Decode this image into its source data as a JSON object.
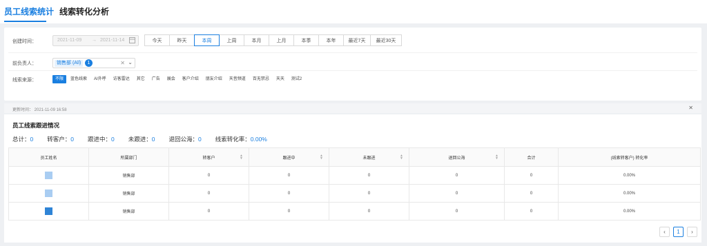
{
  "tabs": [
    {
      "label": "员工线索统计",
      "active": true
    },
    {
      "label": "线索转化分析",
      "active": false
    }
  ],
  "filters": {
    "created_label": "创建时间：",
    "date_start": "2021-11-09",
    "date_sep": "→",
    "date_end": "2021-11-14",
    "quick_ranges": [
      "今天",
      "昨天",
      "本周",
      "上周",
      "本月",
      "上月",
      "本季",
      "本年",
      "最近7天",
      "最近30天"
    ],
    "quick_active": "本周",
    "owner_label": "前负责人：",
    "owner_tag": "销售部 (All)",
    "owner_count": "1",
    "source_label": "线索来源：",
    "sources": [
      "不限",
      "蓝色线索",
      "AI外呼",
      "访客雷达",
      "其它",
      "广告",
      "展会",
      "客户介绍",
      "朋友介绍",
      "天音频道",
      "百无禁忌",
      "天天",
      "测试2"
    ],
    "source_active": "不限"
  },
  "update": {
    "text": "更新时间：  2021-11-09 16:58"
  },
  "section": {
    "title": "员工线索跟进情况",
    "stats": [
      {
        "label": "总计：",
        "value": "0"
      },
      {
        "label": "转客户：",
        "value": "0"
      },
      {
        "label": "跟进中：",
        "value": "0"
      },
      {
        "label": "未跟进：",
        "value": "0"
      },
      {
        "label": "退回公海：",
        "value": "0"
      },
      {
        "label": "线索转化率：",
        "value": "0.00%"
      }
    ]
  },
  "table": {
    "headers": [
      "员工姓名",
      "所属部门",
      "转客户",
      "跟进中",
      "未跟进",
      "退回公海",
      "合计",
      "(线索转客户) 转化率"
    ],
    "rows": [
      {
        "dept": "销售部",
        "converted": "0",
        "following": "0",
        "not_followed": "0",
        "returned": "0",
        "total": "0",
        "rate": "0.00%"
      },
      {
        "dept": "销售部",
        "converted": "0",
        "following": "0",
        "not_followed": "0",
        "returned": "0",
        "total": "0",
        "rate": "0.00%"
      },
      {
        "dept": "销售部",
        "converted": "0",
        "following": "0",
        "not_followed": "0",
        "returned": "0",
        "total": "0",
        "rate": "0.00%"
      }
    ]
  },
  "pagination": {
    "prev": "‹",
    "current": "1",
    "next": "›"
  }
}
